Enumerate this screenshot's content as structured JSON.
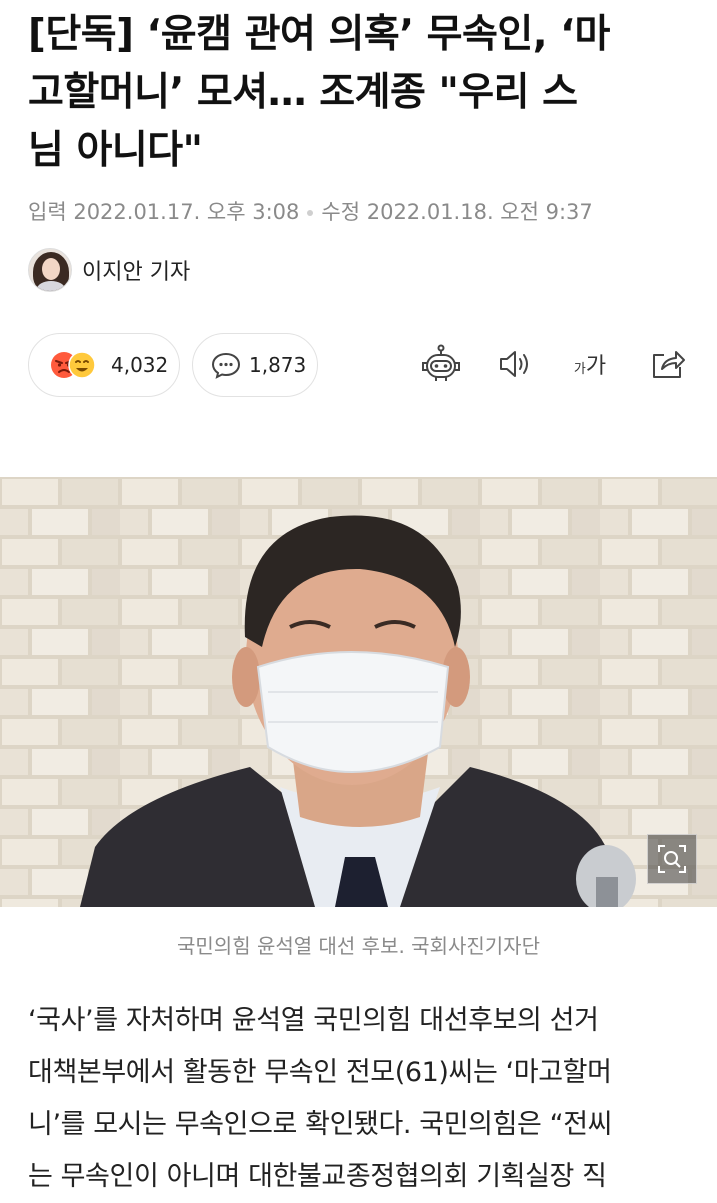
{
  "article": {
    "headline_lines": [
      "[단독] ‘윤캠 관여 의혹’ 무속인, ‘마",
      "고할머니’ 모셔… 조계종 \"우리 스",
      "님 아니다\""
    ],
    "input_label": "입력",
    "input_datetime": "2022.01.17. 오후 3:08",
    "modified_label": "수정",
    "modified_datetime": "2022.01.18. 오전 9:37",
    "reporter": "이지안 기자",
    "reaction_count": "4,032",
    "comment_count": "1,873",
    "font_size_label_small": "가",
    "font_size_label_large": "가",
    "photo_caption": "국민의힘 윤석열 대선 후보. 국회사진기자단",
    "body_lines": [
      "‘국사’를 자처하며 윤석열 국민의힘 대선후보의 선거",
      "대책본부에서 활동한 무속인 전모(61)씨는 ‘마고할머",
      "니’를 모시는 무속인으로 확인됐다. 국민의힘은 “전씨",
      "는 무속인이 아니며 대한불교종정협의회 기획실장 직"
    ]
  },
  "icons": {
    "reaction": [
      "angry-emoji-icon",
      "happy-emoji-icon"
    ],
    "comment": "speech-bubble-icon",
    "toolbar": [
      "robot-summary-icon",
      "speaker-icon",
      "font-size-icon",
      "share-icon"
    ],
    "photo": "zoom-icon"
  },
  "colors": {
    "text": "#111111",
    "meta": "#8a8a8a",
    "angry": "#ff5a3c",
    "happy": "#ffc93c"
  }
}
